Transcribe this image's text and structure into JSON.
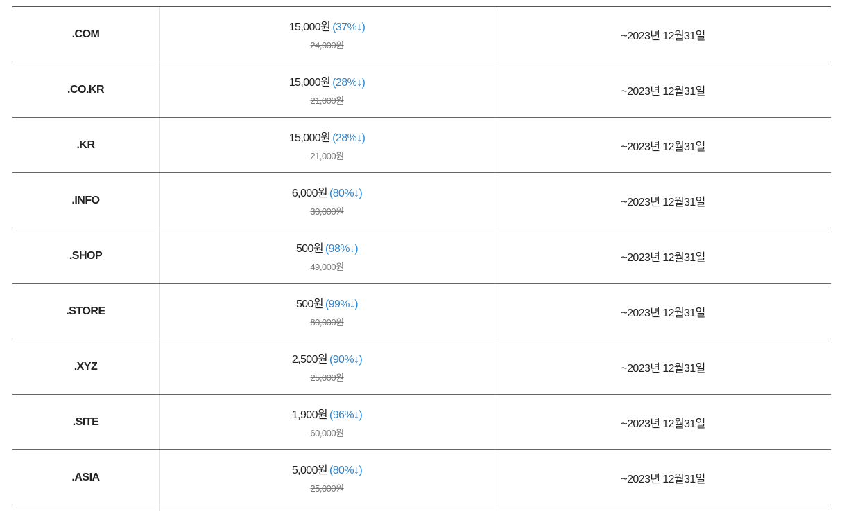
{
  "rows": [
    {
      "domain": ".COM",
      "price": "15,000원",
      "discount": "(37%↓)",
      "original": "24,000원",
      "period": "~2023년 12월31일"
    },
    {
      "domain": ".CO.KR",
      "price": "15,000원",
      "discount": "(28%↓)",
      "original": "21,000원",
      "period": "~2023년 12월31일"
    },
    {
      "domain": ".KR",
      "price": "15,000원",
      "discount": "(28%↓)",
      "original": "21,000원",
      "period": "~2023년 12월31일"
    },
    {
      "domain": ".INFO",
      "price": "6,000원",
      "discount": "(80%↓)",
      "original": "30,000원",
      "period": "~2023년 12월31일"
    },
    {
      "domain": ".SHOP",
      "price": "500원",
      "discount": "(98%↓)",
      "original": "49,000원",
      "period": "~2023년 12월31일"
    },
    {
      "domain": ".STORE",
      "price": "500원",
      "discount": "(99%↓)",
      "original": "80,000원",
      "period": "~2023년 12월31일"
    },
    {
      "domain": ".XYZ",
      "price": "2,500원",
      "discount": "(90%↓)",
      "original": "25,000원",
      "period": "~2023년 12월31일"
    },
    {
      "domain": ".SITE",
      "price": "1,900원",
      "discount": "(96%↓)",
      "original": "60,000원",
      "period": "~2023년 12월31일"
    },
    {
      "domain": ".ASIA",
      "price": "5,000원",
      "discount": "(80%↓)",
      "original": "25,000원",
      "period": "~2023년 12월31일"
    }
  ],
  "colors": {
    "discount": "#2a86d1",
    "border": "#666666",
    "divider": "#e2e2e2"
  }
}
